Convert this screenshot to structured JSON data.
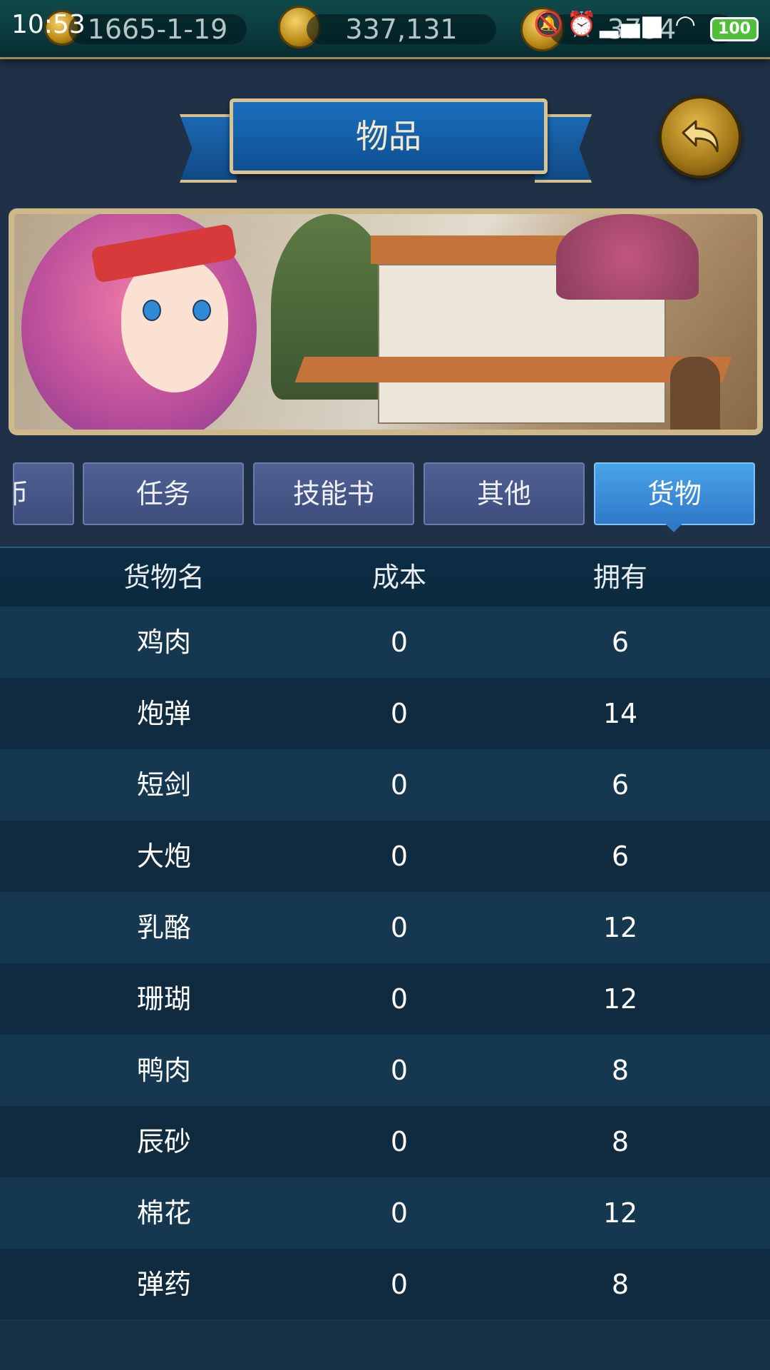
{
  "status_bar": {
    "time": "10:53",
    "icons": "🔕⏰▂▄▆ ◠",
    "battery": "100"
  },
  "resources": {
    "date": "1665-1-19",
    "money": "337,131",
    "gold": "3734"
  },
  "header": {
    "title": "物品",
    "back_icon": "back-arrow-icon"
  },
  "tabs": [
    {
      "label": "币"
    },
    {
      "label": "任务"
    },
    {
      "label": "技能书"
    },
    {
      "label": "其他"
    },
    {
      "label": "货物",
      "active": true
    }
  ],
  "table": {
    "columns": [
      "货物名",
      "成本",
      "拥有"
    ],
    "rows": [
      {
        "name": "鸡肉",
        "cost": "0",
        "owned": "6"
      },
      {
        "name": "炮弹",
        "cost": "0",
        "owned": "14"
      },
      {
        "name": "短剑",
        "cost": "0",
        "owned": "6"
      },
      {
        "name": "大炮",
        "cost": "0",
        "owned": "6"
      },
      {
        "name": "乳酪",
        "cost": "0",
        "owned": "12"
      },
      {
        "name": "珊瑚",
        "cost": "0",
        "owned": "12"
      },
      {
        "name": "鸭肉",
        "cost": "0",
        "owned": "8"
      },
      {
        "name": "辰砂",
        "cost": "0",
        "owned": "8"
      },
      {
        "name": "棉花",
        "cost": "0",
        "owned": "12"
      },
      {
        "name": "弹药",
        "cost": "0",
        "owned": "8"
      }
    ]
  },
  "colors": {
    "active_tab": "#3a8fdc",
    "tab": "#46578a",
    "ribbon": "#1560a8"
  }
}
